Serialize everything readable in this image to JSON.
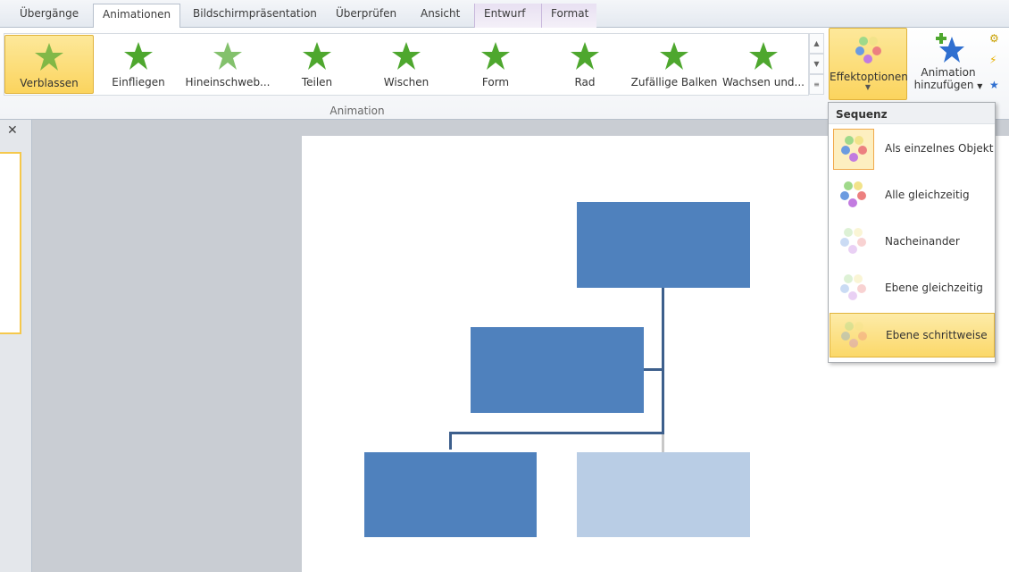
{
  "tabs": [
    {
      "label": "Übergänge"
    },
    {
      "label": "Animationen",
      "active": true
    },
    {
      "label": "Bildschirmpräsentation"
    },
    {
      "label": "Überprüfen"
    },
    {
      "label": "Ansicht"
    },
    {
      "label": "Entwurf",
      "contextual": true
    },
    {
      "label": "Format",
      "contextual": true
    }
  ],
  "gallery": {
    "items": [
      {
        "label": "Verblassen",
        "selected": true
      },
      {
        "label": "Einfliegen"
      },
      {
        "label": "Hineinschweb..."
      },
      {
        "label": "Teilen"
      },
      {
        "label": "Wischen"
      },
      {
        "label": "Form"
      },
      {
        "label": "Rad"
      },
      {
        "label": "Zufällige Balken"
      },
      {
        "label": "Wachsen und..."
      }
    ],
    "group_label": "Animation"
  },
  "effect_options": {
    "label": "Effektoptionen"
  },
  "add_animation": {
    "label_line1": "Animation",
    "label_line2": "hinzufügen"
  },
  "menu": {
    "header": "Sequenz",
    "items": [
      {
        "label": "Als einzelnes Objekt",
        "selected": true
      },
      {
        "label": "Alle gleichzeitig"
      },
      {
        "label": "Nacheinander"
      },
      {
        "label": "Ebene gleichzeitig"
      },
      {
        "label": "Ebene schrittweise",
        "hovered": true
      }
    ]
  },
  "colors": {
    "accent": "#fbd45e",
    "shape": "#4f81bd",
    "shape_light": "#b9cde5",
    "star": "#4ea72e"
  }
}
